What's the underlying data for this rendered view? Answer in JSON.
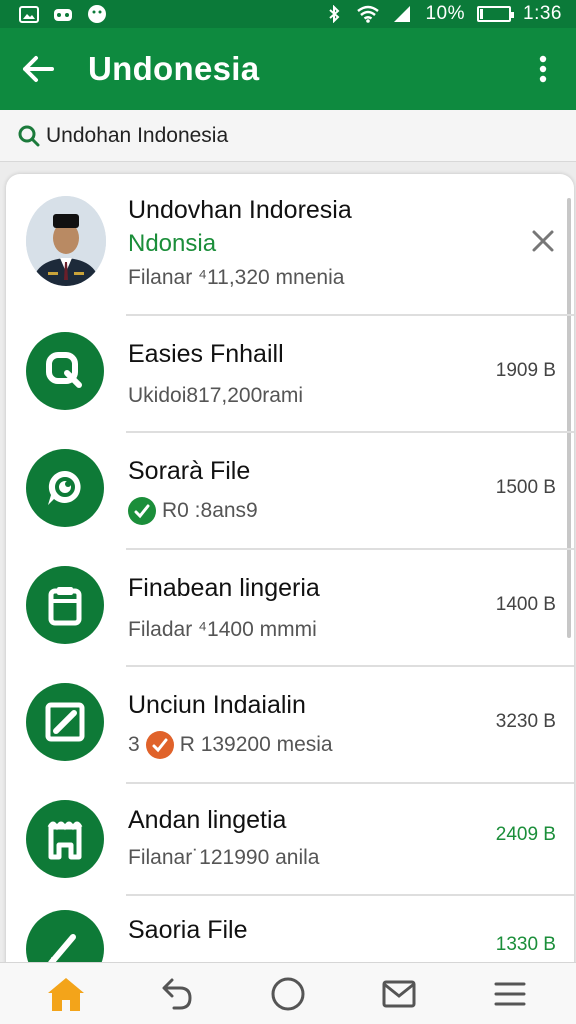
{
  "status_bar": {
    "battery_text": "10%",
    "time": "1:36",
    "battery_level": 0.1
  },
  "app_bar": {
    "title": "Undonesia"
  },
  "search": {
    "text": "Undohan Indonesia"
  },
  "items": [
    {
      "title": "Undovhan Indoresia",
      "highlight": "Ndonsia",
      "subtitle": "Filanar ⁴11,320 mnenia",
      "icon": "person-photo",
      "action": "close-icon"
    },
    {
      "title": "Easies Fnhaill",
      "subtitle": "Ukidoi817,200rami",
      "size": "1909 B",
      "icon": "search-magnifier-icon"
    },
    {
      "title": "Sorarà File",
      "subtitle": "R0 :8ans9",
      "size": "1500 B",
      "icon": "chat-bubble-icon",
      "badge": "check-badge-icon"
    },
    {
      "title": "Finabean lingeria",
      "subtitle": "Filadar ⁴1400 mmmi",
      "size": "1400 B",
      "icon": "clipboard-icon"
    },
    {
      "title": "Unciun Indaialin",
      "subtitle_prefix": "3",
      "subtitle": "R 139200 mesia",
      "size": "3230 B",
      "icon": "edit-note-icon",
      "badge": "orange-check-badge-icon"
    },
    {
      "title": "Andan lingetia",
      "subtitle": "Filanar˙121990 anila",
      "size": "2409 B",
      "icon": "store-icon"
    },
    {
      "title": "Saoria File",
      "size": "1330 B",
      "icon": "pen-icon"
    }
  ],
  "colors": {
    "primary": "#0e8a3f",
    "status_bar": "#0b7a39",
    "icon_circle": "#0e7a37",
    "accent_green": "#1b8e3a",
    "orange": "#e0622a",
    "nav_home": "#f3a41a"
  },
  "bottom_nav": [
    "home-icon",
    "back-arrow-icon",
    "circle-icon",
    "mail-icon",
    "menu-icon"
  ]
}
